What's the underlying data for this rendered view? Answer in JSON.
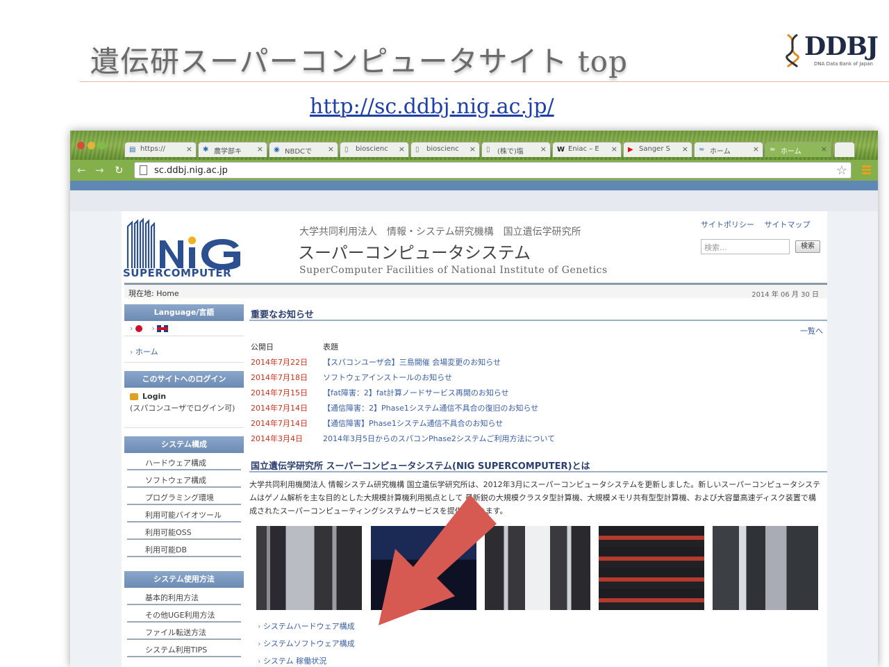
{
  "slide": {
    "title": "遺伝研スーパーコンピュータサイト top",
    "url": "http://sc.ddbj.nig.ac.jp/",
    "logo_text": "DDBJ",
    "logo_sub": "DNA Data Bank of Japan"
  },
  "browser": {
    "tabs": [
      {
        "label": "https://"
      },
      {
        "label": "農学部キ"
      },
      {
        "label": "NBDCで"
      },
      {
        "label": "bioscienc"
      },
      {
        "label": "bioscienc"
      },
      {
        "label": "(株で)塩"
      },
      {
        "label": "Eniac – E"
      },
      {
        "label": "Sanger S"
      },
      {
        "label": "ホーム"
      },
      {
        "label": "ホーム"
      }
    ],
    "address": "sc.ddbj.nig.ac.jp"
  },
  "site": {
    "logo_sub": "SUPERCOMPUTER",
    "org": "大学共同利用法人　情報・システム研究機構　国立遺伝学研究所",
    "title": "スーパーコンピュータシステム",
    "title_en": "SuperComputer Facilities of National Institute of Genetics",
    "site_policy": "サイトポリシー",
    "site_map": "サイトマップ",
    "search_placeholder": "検索...",
    "search_button": "検索",
    "breadcrumb": "現在地: Home",
    "date": "2014 年 06 月 30 日"
  },
  "sidebar": {
    "language_head": "Language/言語",
    "home": "ホーム",
    "login_head": "このサイトへのログイン",
    "login": "Login",
    "login_note": "(スパコンユーザでログイン可)",
    "system_head": "システム構成",
    "system_items": [
      "ハードウェア構成",
      "ソフトウェア構成",
      "プログラミング環境",
      "利用可能バイオツール",
      "利用可能OSS",
      "利用可能DB"
    ],
    "usage_head": "システム使用方法",
    "usage_items": [
      "基本的利用方法",
      "その他UGE利用方法",
      "ファイル転送方法",
      "システム利用TIPS"
    ]
  },
  "main": {
    "news_head": "重要なお知らせ",
    "all_link": "一覧へ",
    "col_date": "公開日",
    "col_title": "表題",
    "news": [
      {
        "date": "2014年7月22日",
        "title": "【スパコンユーザ会】三島開催 会場変更のお知らせ"
      },
      {
        "date": "2014年7月18日",
        "title": "ソフトウェアインストールのお知らせ"
      },
      {
        "date": "2014年7月15日",
        "title": "【fat障害：2】fat計算ノードサービス再開のお知らせ"
      },
      {
        "date": "2014年7月14日",
        "title": "【通信障害：2】Phase1システム通信不具合の復旧のお知らせ"
      },
      {
        "date": "2014年7月14日",
        "title": "【通信障害】Phase1システム通信不具合のお知らせ"
      },
      {
        "date": "2014年3月4日",
        "title": "2014年3月5日からのスパコンPhase2システムご利用方法について"
      }
    ],
    "about_head": "国立遺伝学研究所 スーパーコンピュータシステム(NIG SUPERCOMPUTER)とは",
    "intro": "大学共同利用機関法人 情報システム研究機構 国立遺伝学研究所は、2012年3月にスーパーコンピュータシステムを更新しました。新しいスーパーコンピュータシステムはゲノム解析を主な目的とした大規模計算機利用拠点として 最新鋭の大規模クラスタ型計算機、大規模メモリ共有型型計算機、および大容量高速ディスク装置で構成されたスーパーコンピューティングシステムサービスを提供しています。",
    "links": [
      "システムハードウェア構成",
      "システムソフトウェア構成",
      "システム 稼働状況"
    ]
  },
  "colors": {
    "arrow": "#d65a52",
    "accent": "#3a5fa4",
    "news_date": "#c8311d"
  }
}
